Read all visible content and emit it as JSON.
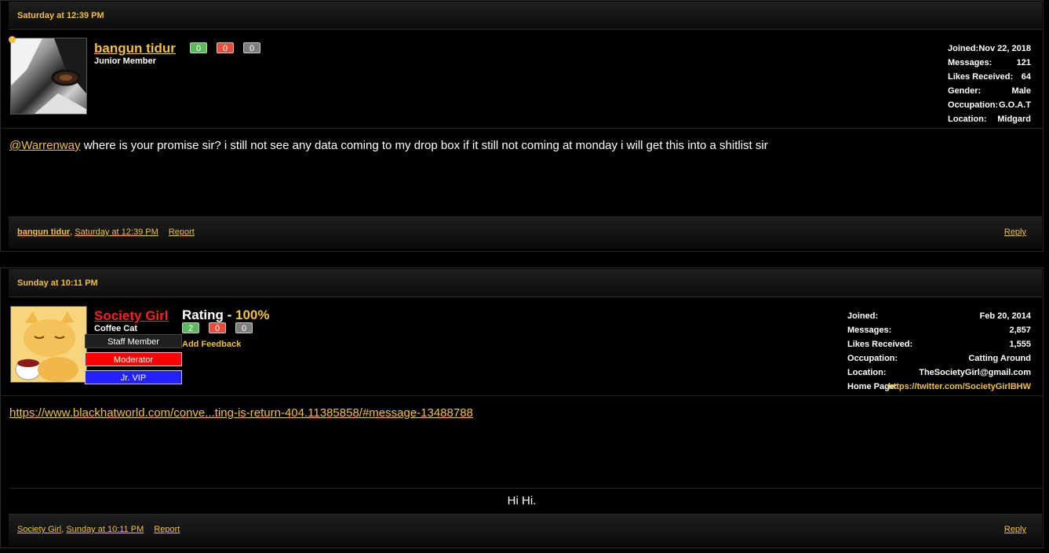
{
  "colors": {
    "accent": "#f0c040",
    "moderator_red": "#ff0000",
    "vip_blue": "#2222ff",
    "staff_bg": "#202020",
    "fb_positive": "#5cb85c",
    "fb_negative": "#e74c3c",
    "fb_neutral": "#7d7d7d"
  },
  "posts": [
    {
      "date": "Saturday at 12:39 PM",
      "username": "bangun tidur",
      "user_title": "Junior Member",
      "feedback": {
        "positive": "0",
        "negative": "0",
        "neutral": "0"
      },
      "stats": [
        {
          "label": "Joined:",
          "value": "Nov 22, 2018"
        },
        {
          "label": "Messages:",
          "value": "121"
        },
        {
          "label": "Likes Received:",
          "value": "64"
        },
        {
          "label": "Gender:",
          "value": "Male"
        },
        {
          "label": "Occupation:",
          "value": "G.O.A.T"
        },
        {
          "label": "Location:",
          "value": "Midgard"
        }
      ],
      "mention": "@Warrenway",
      "message": "where is your promise sir? i still not see any data coming to my drop box if it still not coming at monday i will get this into a shitlist sir",
      "footer_user": "bangun tidur",
      "footer_date": "Saturday at 12:39 PM",
      "report": "Report",
      "reply": "Reply"
    },
    {
      "date": "Sunday at 10:11 PM",
      "username": "Society Girl",
      "user_title": "Coffee Cat",
      "rating_label": "Rating - ",
      "rating_value": "100%",
      "feedback": {
        "positive": "2",
        "negative": "0",
        "neutral": "0"
      },
      "add_feedback": "Add Feedback",
      "badges": {
        "staff": "Staff Member",
        "moderator": "Moderator",
        "vip": "Jr. VIP"
      },
      "stats": [
        {
          "label": "Joined:",
          "value": "Feb 20, 2014"
        },
        {
          "label": "Messages:",
          "value": "2,857"
        },
        {
          "label": "Likes Received:",
          "value": "1,555"
        },
        {
          "label": "Occupation:",
          "value": "Catting Around"
        },
        {
          "label": "Location:",
          "value": "TheSocietyGirl@gmail.com"
        },
        {
          "label": "Home Page:",
          "value": "https://twitter.com/SocietyGirlBHW"
        }
      ],
      "link": "https://www.blackhatworld.com/conve...ting-is-return-404.11385858/#message-13488788",
      "signature": "Hi Hi.",
      "footer_user": "Society Girl",
      "footer_date": "Sunday at 10:11 PM",
      "report": "Report",
      "reply": "Reply"
    }
  ]
}
